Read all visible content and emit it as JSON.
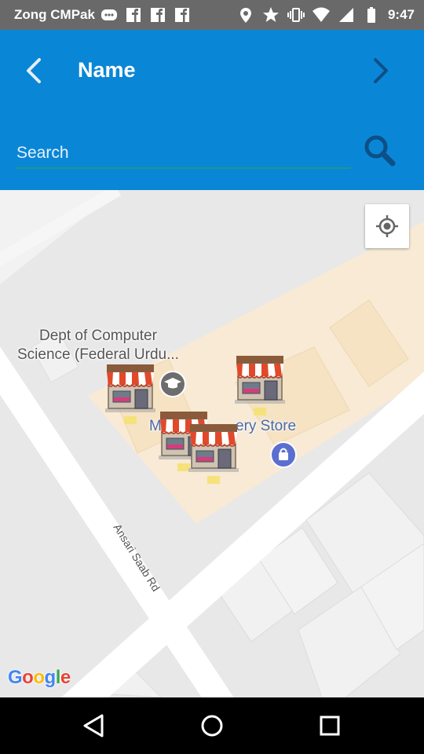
{
  "status_bar": {
    "carrier": "Zong CMPak",
    "time": "9:47",
    "icons": [
      "messenger-icon",
      "facebook-icon",
      "facebook-icon",
      "facebook-icon",
      "location-icon",
      "star-icon",
      "vibrate-icon",
      "wifi-icon",
      "signal-icon",
      "battery-icon"
    ]
  },
  "app_bar": {
    "title": "Name",
    "back_icon": "chevron-left-icon",
    "forward_icon": "chevron-right-icon",
    "search": {
      "placeholder": "Search",
      "value": ""
    },
    "search_icon": "search-icon",
    "colors": {
      "background": "#0a86d6",
      "underline": "#1c9a8a"
    }
  },
  "map": {
    "poi_label_line1": "Dept of Computer",
    "poi_label_line2": "Science (Federal Urdu...",
    "store_label_start": "M",
    "store_label_end": "ery Store",
    "road_label": "Ansari Saab Rd",
    "marker_icon": "store-icon",
    "marker_count": 4,
    "locate_icon": "my-location-icon",
    "attribution": [
      "G",
      "o",
      "o",
      "g",
      "l",
      "e"
    ],
    "attribution_colors": [
      "#4285F4",
      "#EA4335",
      "#FBBC05",
      "#4285F4",
      "#34A853",
      "#EA4335"
    ]
  },
  "nav_bar": {
    "icons": [
      "back-triangle-icon",
      "home-circle-icon",
      "recents-square-icon"
    ]
  }
}
